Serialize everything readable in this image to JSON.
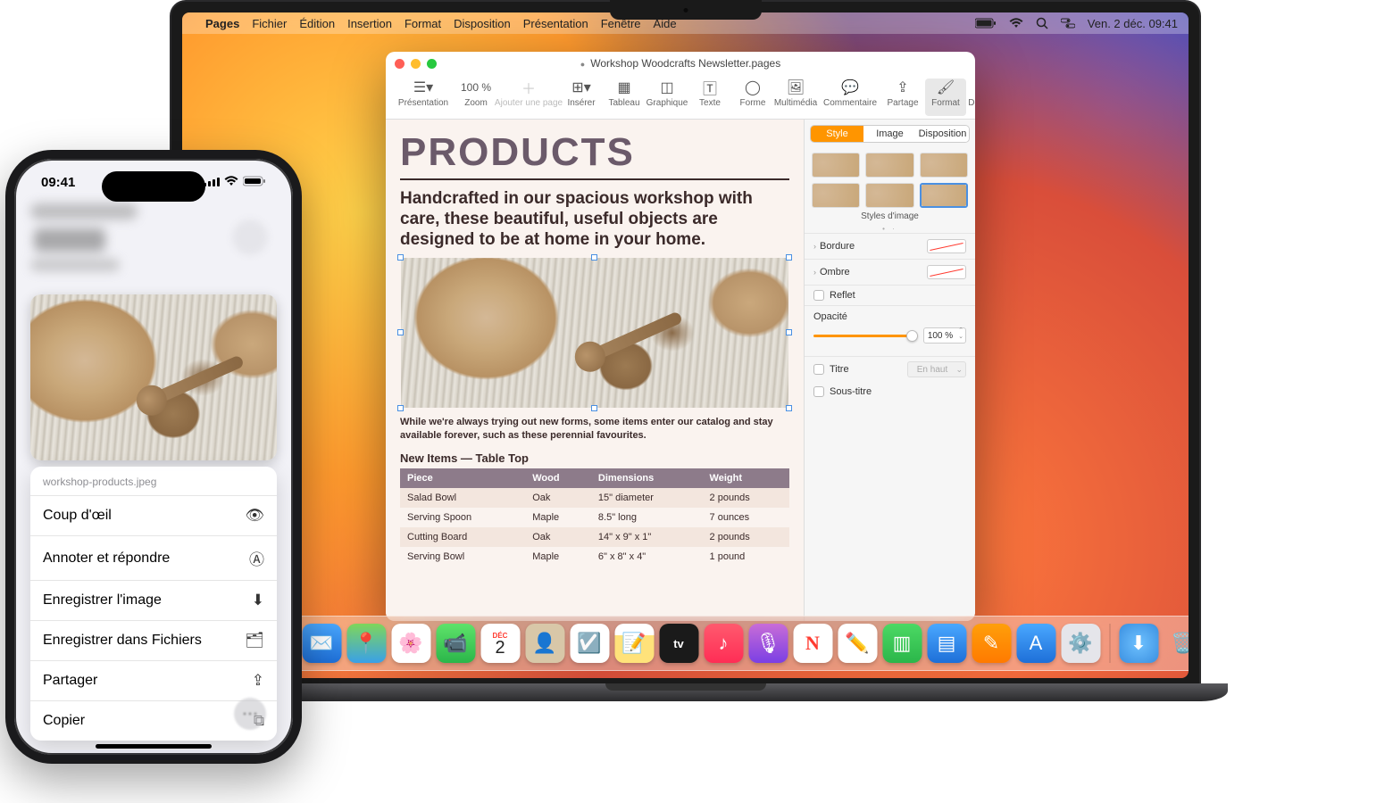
{
  "menubar": {
    "app": "Pages",
    "items": [
      "Fichier",
      "Édition",
      "Insertion",
      "Format",
      "Disposition",
      "Présentation",
      "Fenêtre",
      "Aide"
    ],
    "datetime": "Ven. 2 déc. 09:41"
  },
  "window": {
    "title": "Workshop Woodcrafts Newsletter.pages",
    "toolbar": {
      "presentation": "Présentation",
      "zoom": "Zoom",
      "zoom_value": "100 %",
      "add_page": "Ajouter une page",
      "insert": "Insérer",
      "table": "Tableau",
      "chart": "Graphique",
      "text": "Texte",
      "shape": "Forme",
      "media": "Multimédia",
      "comment": "Commentaire",
      "share": "Partage",
      "format": "Format",
      "document": "Document"
    }
  },
  "document": {
    "h1": "PRODUCTS",
    "lead": "Handcrafted in our spacious workshop with care, these beautiful, useful objects are designed to be at home in your home.",
    "body": "While we're always trying out new forms, some items enter our catalog and stay available forever, such as these perennial favourites.",
    "table_title": "New Items — Table Top",
    "columns": [
      "Piece",
      "Wood",
      "Dimensions",
      "Weight"
    ],
    "rows": [
      [
        "Salad Bowl",
        "Oak",
        "15\" diameter",
        "2 pounds"
      ],
      [
        "Serving Spoon",
        "Maple",
        "8.5\" long",
        "7 ounces"
      ],
      [
        "Cutting Board",
        "Oak",
        "14\" x 9\" x 1\"",
        "2 pounds"
      ],
      [
        "Serving Bowl",
        "Maple",
        "6\" x 8\" x 4\"",
        "1 pound"
      ]
    ]
  },
  "inspector": {
    "tabs": {
      "style": "Style",
      "image": "Image",
      "arrange": "Disposition"
    },
    "styles_label": "Styles d'image",
    "border": "Bordure",
    "shadow": "Ombre",
    "reflect": "Reflet",
    "opacity": "Opacité",
    "opacity_value": "100 %",
    "title": "Titre",
    "subtitle": "Sous-titre",
    "position": "En haut"
  },
  "iphone": {
    "time": "09:41",
    "filename": "workshop-products.jpeg",
    "menu": {
      "quicklook": "Coup d'œil",
      "annotate": "Annoter et répondre",
      "save_image": "Enregistrer l'image",
      "save_files": "Enregistrer dans Fichiers",
      "share": "Partager",
      "copy": "Copier"
    }
  },
  "dock": {
    "apps": [
      "finder",
      "safari",
      "messages",
      "mail",
      "maps",
      "photos",
      "facetime",
      "calendar",
      "contacts",
      "reminders",
      "notes",
      "tv",
      "music",
      "podcasts",
      "news",
      "numbers",
      "keynote",
      "pages",
      "appstore",
      "settings"
    ],
    "calendar_month": "DÉC",
    "calendar_day": "2"
  }
}
